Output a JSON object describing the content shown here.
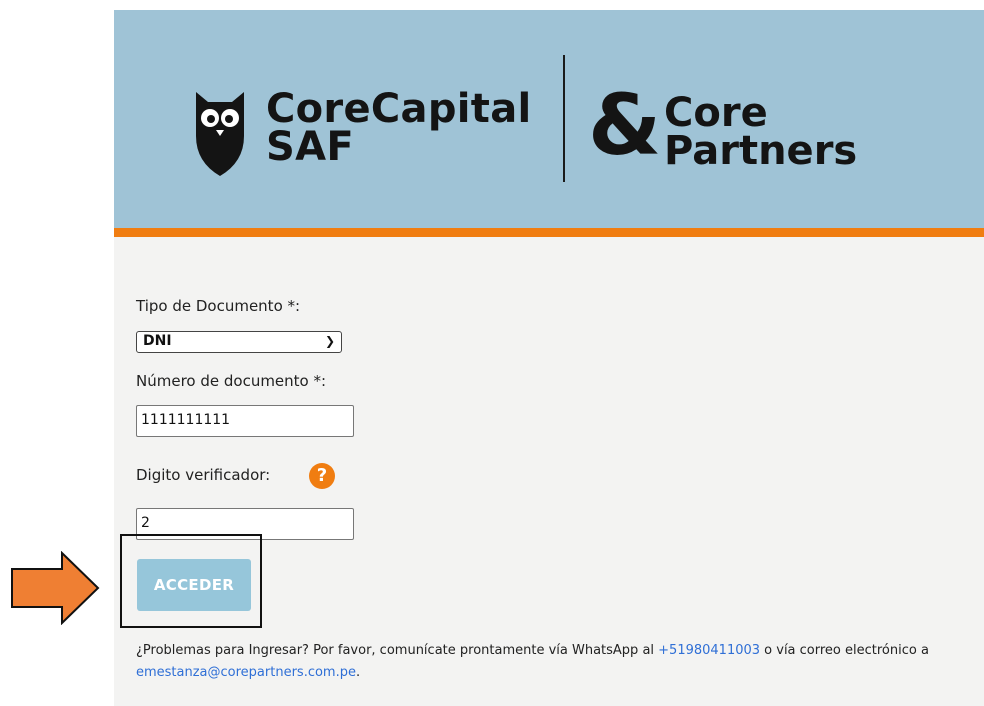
{
  "header": {
    "brand_line1": "CoreCapital",
    "brand_line2": "SAF",
    "partner_symbol": "&",
    "partner_line1": "Core",
    "partner_line2": "Partners"
  },
  "form": {
    "doc_type_label": "Tipo de Documento *:",
    "doc_type_value": "DNI",
    "doc_number_label": "Número de documento *:",
    "doc_number_value": "1111111111",
    "check_digit_label": "Digito verificador:",
    "check_digit_value": "2",
    "help_symbol": "?",
    "submit_label": "ACCEDER"
  },
  "footer": {
    "text_before_phone": "¿Problemas para Ingresar? Por favor, comunícate prontamente vía WhatsApp al ",
    "phone": "+51980411003",
    "text_before_email": " o vía correo electrónico a ",
    "email": "emestanza@corepartners.com.pe",
    "text_end": "."
  },
  "colors": {
    "header_bg": "#9fc3d6",
    "accent_orange": "#f07d11",
    "button_bg": "#96c6da",
    "link": "#2f6fd6"
  },
  "icons": {
    "logo": "owl-icon",
    "dropdown": "chevron-down-icon",
    "help": "question-icon",
    "pointer": "arrow-right-icon"
  }
}
